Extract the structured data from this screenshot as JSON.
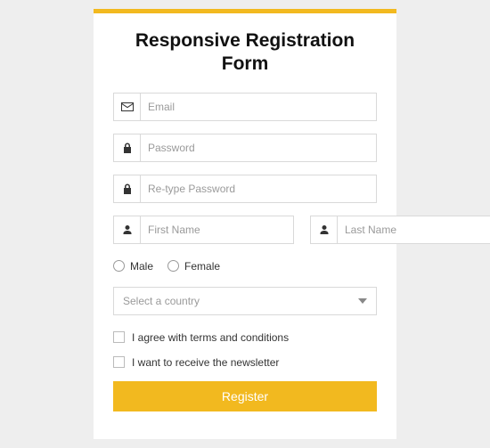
{
  "title": "Responsive Registration Form",
  "fields": {
    "email": {
      "placeholder": "Email"
    },
    "password": {
      "placeholder": "Password"
    },
    "retype_password": {
      "placeholder": "Re-type Password"
    },
    "first_name": {
      "placeholder": "First Name"
    },
    "last_name": {
      "placeholder": "Last Name"
    }
  },
  "gender": {
    "male": "Male",
    "female": "Female"
  },
  "country_placeholder": "Select a country",
  "checks": {
    "terms": "I agree with terms and conditions",
    "newsletter": "I want to receive the newsletter"
  },
  "submit_label": "Register"
}
